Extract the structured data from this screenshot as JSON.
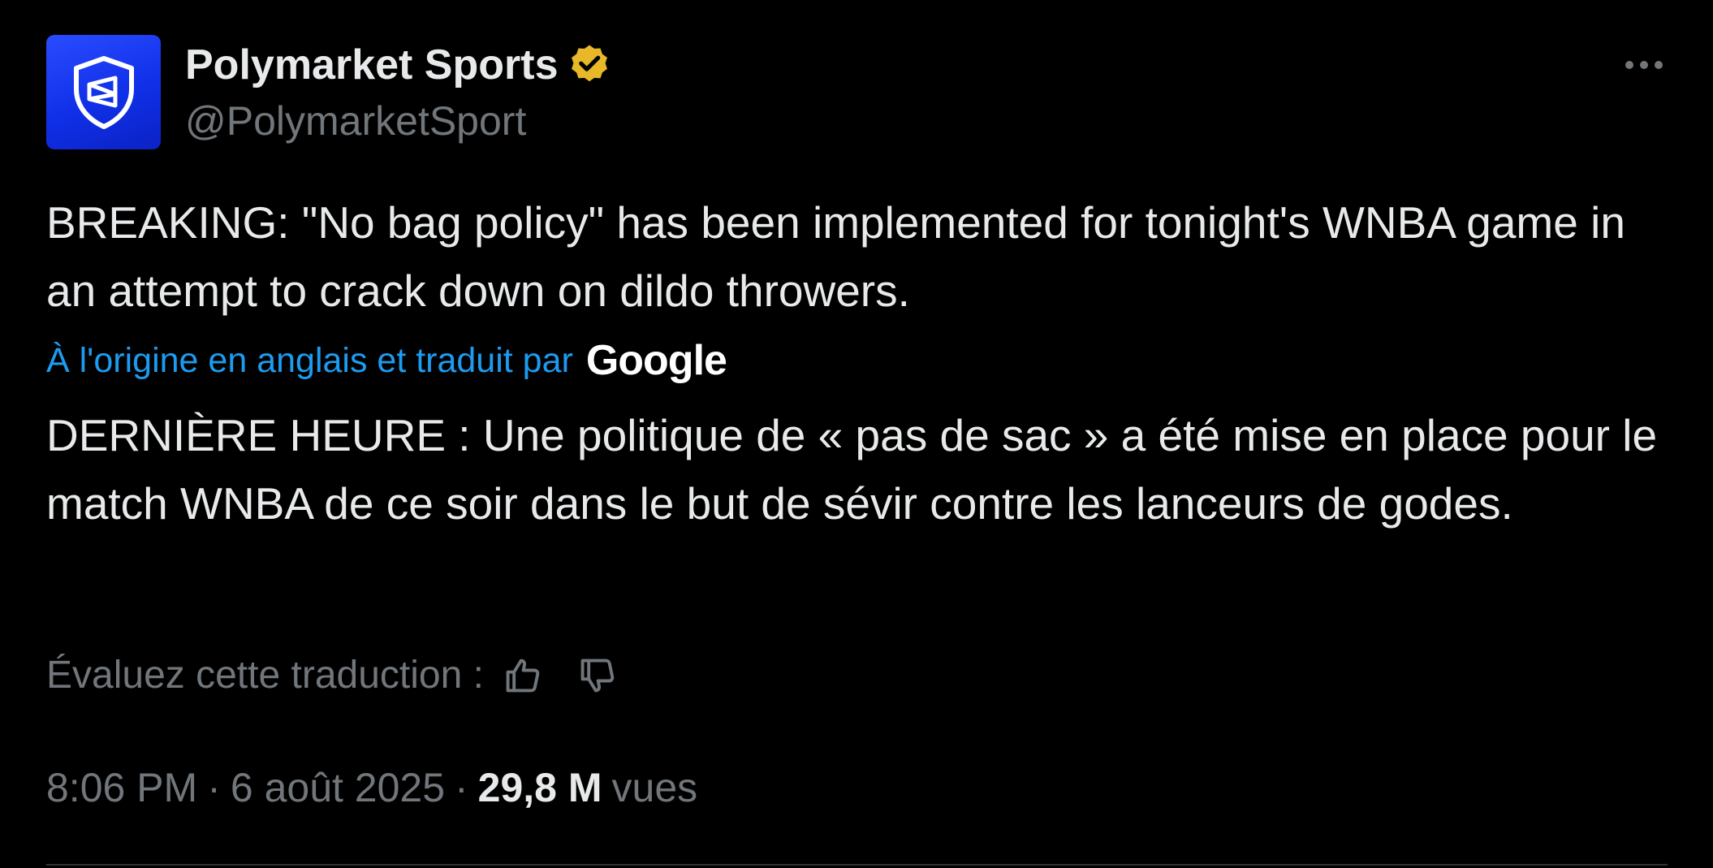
{
  "author": {
    "name": "Polymarket Sports",
    "handle": "@PolymarketSport",
    "verified_badge_color": "#e8b829",
    "avatar_bg": "#1a3af0"
  },
  "tweet": {
    "original_text": "BREAKING: \"No bag policy\" has been implemented for tonight's WNBA game in an attempt to crack down on dildo throwers.",
    "translation_label": "À l'origine en anglais et traduit par",
    "translation_provider": "Google",
    "translated_text": "DERNIÈRE HEURE : Une politique de « pas de sac » a été mise en place pour le match WNBA de ce soir dans le but de sévir contre les lanceurs de godes.",
    "rate_label": "Évaluez cette traduction :"
  },
  "meta": {
    "time": "8:06 PM",
    "separator": "·",
    "date": "6 août 2025",
    "views_count": "29,8 M",
    "views_label": "vues"
  },
  "icons": {
    "more": "more-horizontal-icon",
    "verified": "verified-badge-icon",
    "thumbs_up": "thumbs-up-icon",
    "thumbs_down": "thumbs-down-icon"
  },
  "colors": {
    "background": "#000000",
    "text_primary": "#e7e9ea",
    "text_secondary": "#71767b",
    "link": "#1d9bf0"
  }
}
